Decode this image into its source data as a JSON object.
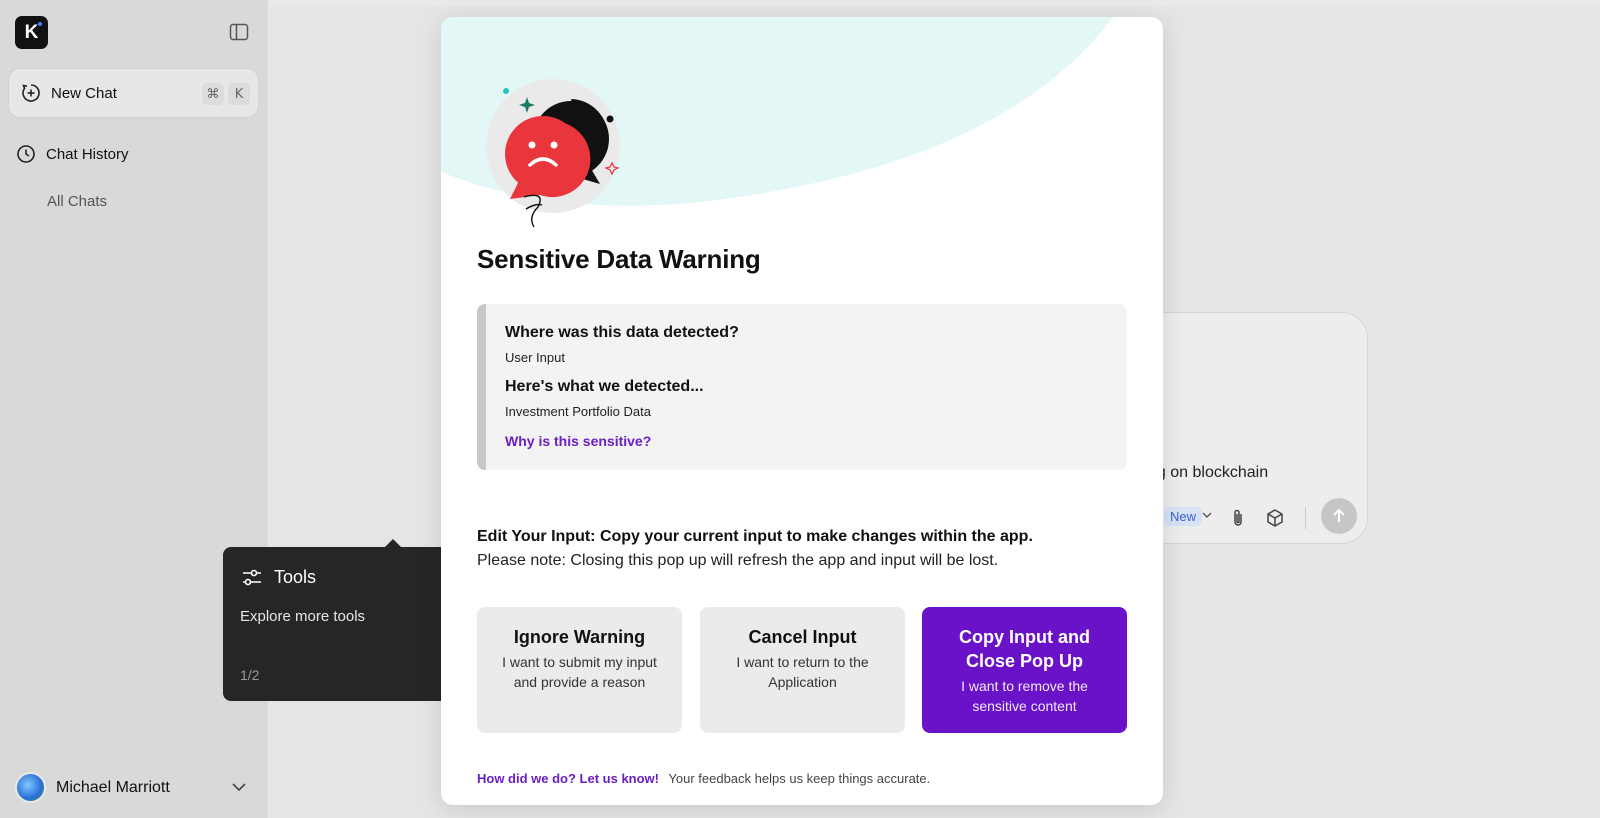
{
  "sidebar": {
    "logo_letter": "K",
    "new_chat_label": "New Chat",
    "shortcut_cmd": "⌘",
    "shortcut_key": "K",
    "chat_history_label": "Chat History",
    "all_chats_label": "All Chats",
    "user_name": "Michael Marriott"
  },
  "composer": {
    "visible_text": "ng on blockchain",
    "model_badge": "New"
  },
  "tooltip": {
    "title": "Tools",
    "description": "Explore more tools",
    "pagination": "1/2"
  },
  "modal": {
    "title": "Sensitive Data Warning",
    "q1": "Where was this data detected?",
    "a1": "User Input",
    "q2": "Here's what we detected...",
    "a2": "Investment Portfolio Data",
    "why_link": "Why is this sensitive?",
    "edit_instruction": "Edit Your Input: Copy your current input to make changes within the app.",
    "note": "Please note: Closing this pop up will refresh the app and input will be lost.",
    "options": [
      {
        "title": "Ignore Warning",
        "desc": "I want to submit my input and provide a reason"
      },
      {
        "title": "Cancel Input",
        "desc": "I want to return to the Application"
      },
      {
        "title": "Copy Input and Close Pop Up",
        "desc": "I want to remove the sensitive content"
      }
    ],
    "feedback_link": "How did we do? Let us know!",
    "feedback_text": "Your feedback helps us keep things accurate."
  },
  "colors": {
    "accent_purple": "#6a12c8",
    "warning_red": "#e8363c",
    "mint_bg": "#e3f7f7"
  },
  "icons": [
    "sidebar-toggle-icon",
    "plus-circle-icon",
    "clock-icon",
    "chevron-down-icon",
    "sliders-icon",
    "paperclip-icon",
    "cube-icon",
    "arrow-up-icon"
  ]
}
